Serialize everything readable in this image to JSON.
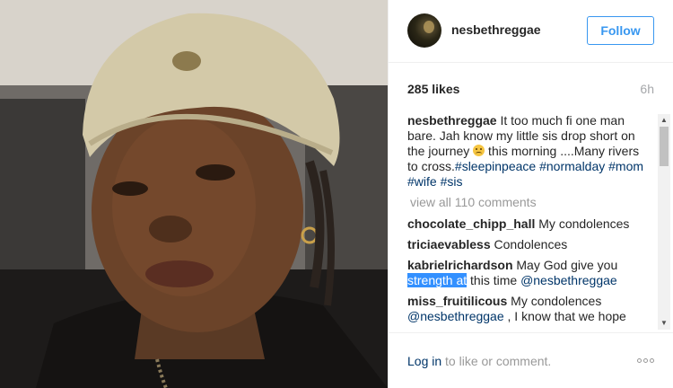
{
  "post": {
    "username": "nesbethreggae",
    "follow_label": "Follow",
    "likes": "285 likes",
    "time": "6h",
    "caption": {
      "username": "nesbethreggae",
      "text_part1": " It too much fi one man bare. Jah know my little sis drop short on the journey ",
      "text_part2": " this morning ....Many rivers to cross.",
      "hashtags": [
        "#sleepinpeace",
        "#normalday",
        "#mom",
        "#wife",
        "#sis"
      ]
    },
    "view_all": "view all 110 comments",
    "comments": [
      {
        "username": "chocolate_chipp_hall",
        "text": " My condolences"
      },
      {
        "username": "triciaevabless",
        "text": " Condolences"
      },
      {
        "username": "kabrielrichardson",
        "text_before": " May God give you ",
        "highlight": "strength at",
        "text_after": " this time ",
        "mention": "@nesbethreggae"
      },
      {
        "username": "miss_fruitilicous",
        "text": " My condolences ",
        "mention": "@nesbethreggae",
        "text_after": " , I know that we hope"
      }
    ],
    "footer": {
      "login_label": "Log in",
      "login_suffix": " to like or comment."
    }
  },
  "icons": {
    "emoji": "sad-face-icon",
    "more": "more-options-icon",
    "scroll_up": "scroll-up-icon",
    "scroll_down": "scroll-down-icon"
  },
  "colors": {
    "link_blue": "#3897f0",
    "hashtag": "#003569",
    "muted": "#999999"
  }
}
